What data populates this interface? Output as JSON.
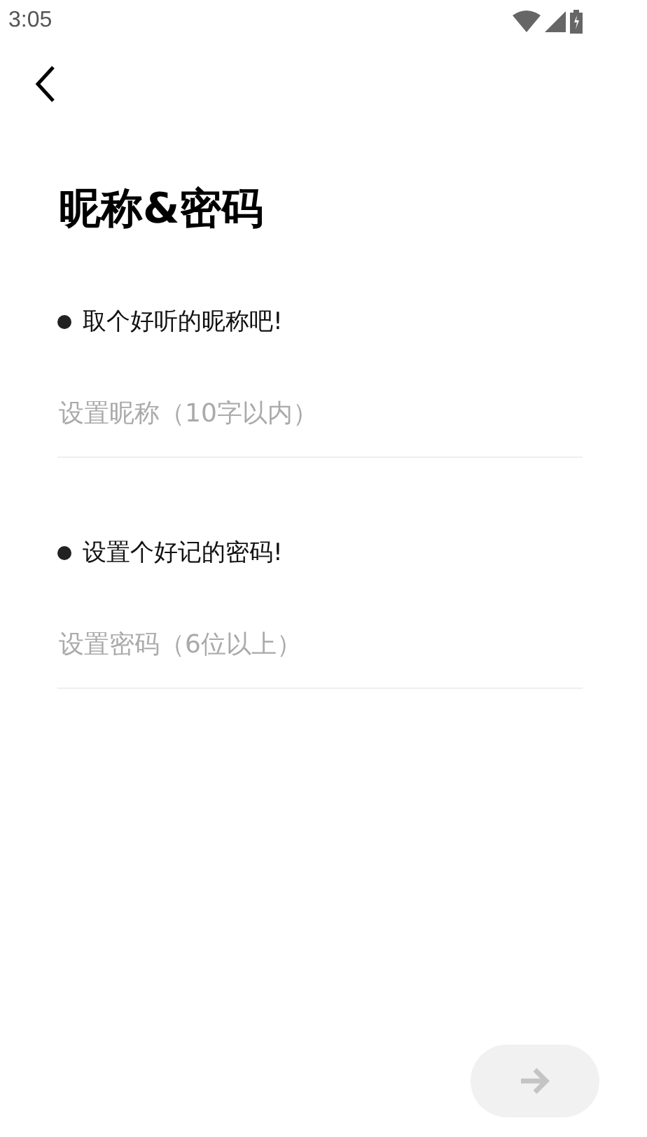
{
  "status_bar": {
    "time": "3:05"
  },
  "title": "昵称&密码",
  "sections": [
    {
      "prompt": "取个好听的昵称吧!",
      "placeholder": "设置昵称（10字以内）"
    },
    {
      "prompt": "设置个好记的密码!",
      "placeholder": "设置密码（6位以上）"
    }
  ],
  "next_button": {
    "disabled": true
  }
}
